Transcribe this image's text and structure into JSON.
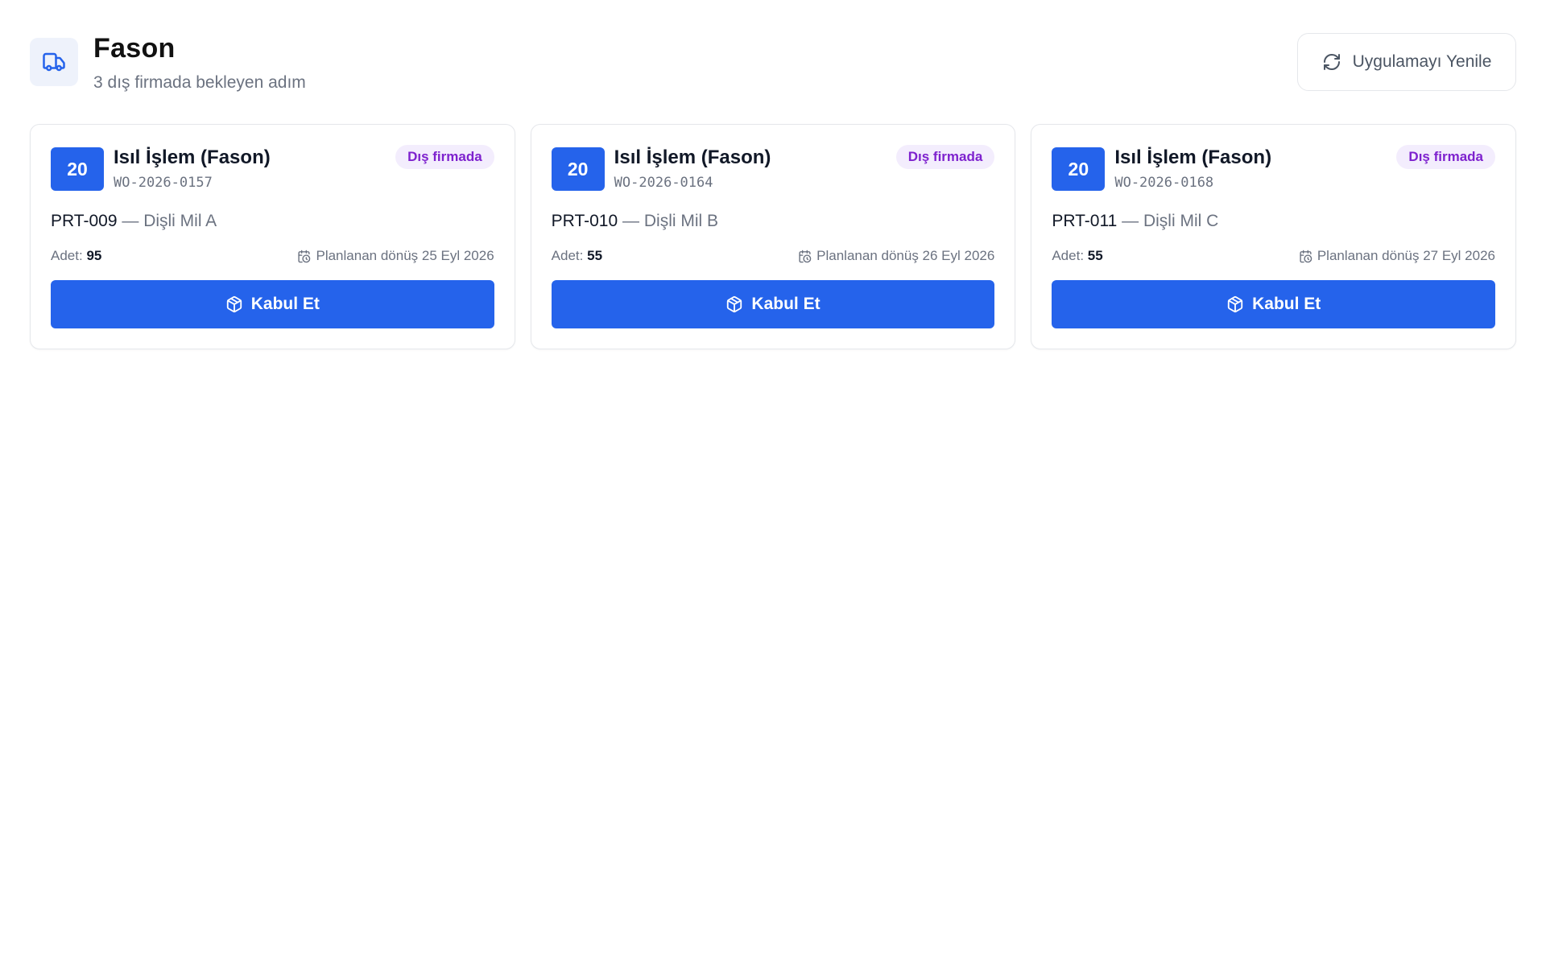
{
  "header": {
    "title": "Fason",
    "subtitle": "3 dış firmada bekleyen adım",
    "icon": "truck-icon",
    "refresh_label": "Uygulamayı Yenile",
    "refresh_icon": "refresh-icon"
  },
  "colors": {
    "accent": "#2563eb",
    "status_bg": "#f3edfd",
    "status_text": "#7e22ce"
  },
  "cards": [
    {
      "step": "20",
      "step_name": "Isıl İşlem (Fason)",
      "order_no": "WO-2026-0157",
      "status": "Dış firmada",
      "part_code": "PRT-009",
      "separator": "—",
      "part_name": "Dişli Mil A",
      "qty_label": "Adet:",
      "qty": "95",
      "return_label": "Planlanan dönüş 25 Eyl 2026",
      "accept_label": "Kabul Et"
    },
    {
      "step": "20",
      "step_name": "Isıl İşlem (Fason)",
      "order_no": "WO-2026-0164",
      "status": "Dış firmada",
      "part_code": "PRT-010",
      "separator": "—",
      "part_name": "Dişli Mil B",
      "qty_label": "Adet:",
      "qty": "55",
      "return_label": "Planlanan dönüş 26 Eyl 2026",
      "accept_label": "Kabul Et"
    },
    {
      "step": "20",
      "step_name": "Isıl İşlem (Fason)",
      "order_no": "WO-2026-0168",
      "status": "Dış firmada",
      "part_code": "PRT-011",
      "separator": "—",
      "part_name": "Dişli Mil C",
      "qty_label": "Adet:",
      "qty": "55",
      "return_label": "Planlanan dönüş 27 Eyl 2026",
      "accept_label": "Kabul Et"
    }
  ]
}
